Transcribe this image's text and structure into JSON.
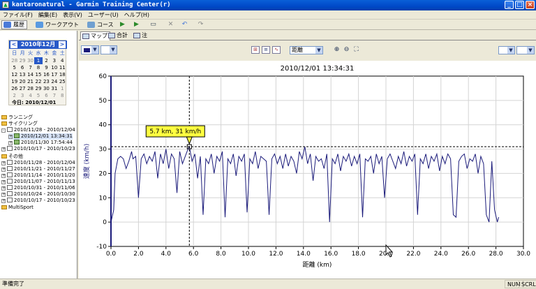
{
  "window": {
    "title": "kantaronatural - Garmin Training Center(r)",
    "app_icon": "garmin-icon"
  },
  "menu": [
    "ファイル(F)",
    "編集(E)",
    "表示(V)",
    "ユーザー(U)",
    "ヘルプ(H)"
  ],
  "toolbar": {
    "history_label": "履歴",
    "workout_label": "ワークアウト",
    "course_label": "コース"
  },
  "calendar": {
    "month_label": "2010年12月",
    "prev": "<",
    "next": ">",
    "weekdays": [
      "日",
      "月",
      "火",
      "水",
      "木",
      "金",
      "土"
    ],
    "days": [
      [
        "28",
        "29",
        "30",
        "1",
        "2",
        "3",
        "4"
      ],
      [
        "5",
        "6",
        "7",
        "8",
        "9",
        "10",
        "11"
      ],
      [
        "12",
        "13",
        "14",
        "15",
        "16",
        "17",
        "18"
      ],
      [
        "19",
        "20",
        "21",
        "22",
        "23",
        "24",
        "25"
      ],
      [
        "26",
        "27",
        "28",
        "29",
        "30",
        "31",
        "1"
      ],
      [
        "2",
        "3",
        "4",
        "5",
        "6",
        "7",
        "8"
      ]
    ],
    "selected_day": "1",
    "today_label": "今日: 2010/12/01"
  },
  "tree": {
    "running": "ランニング",
    "cycling": "サイクリング",
    "cycling_week1": "2010/11/28 - 2010/12/04",
    "cycling_act1": "2010/12/01 13:34:31",
    "cycling_act2": "2010/11/30 17:54:44",
    "cycling_week2": "2010/10/17 - 2010/10/23",
    "other": "その他",
    "other_weeks": [
      "2010/11/28 - 2010/12/04",
      "2010/11/21 - 2010/11/27",
      "2010/11/14 - 2010/11/20",
      "2010/11/07 - 2010/11/13",
      "2010/10/31 - 2010/11/06",
      "2010/10/24 - 2010/10/30",
      "2010/10/17 - 2010/10/23"
    ],
    "multisport": "MultiSport"
  },
  "tabs": {
    "map": "マップ",
    "total": "合計",
    "note": "注"
  },
  "chartbar": {
    "xaxis_select": "距離",
    "color": "#1a1a7a"
  },
  "chart_data": {
    "type": "line",
    "title": "2010/12/01 13:34:31",
    "xlabel": "距離 (km)",
    "ylabel": "速度 (km/h)",
    "xlim": [
      0,
      30
    ],
    "ylim": [
      -10,
      60
    ],
    "xticks": [
      "0.0",
      "2.0",
      "4.0",
      "6.0",
      "8.0",
      "10.0",
      "12.0",
      "14.0",
      "16.0",
      "18.0",
      "20.0",
      "22.0",
      "24.0",
      "26.0",
      "28.0",
      "30.0"
    ],
    "yticks": [
      "-10",
      "0",
      "10",
      "20",
      "30",
      "40",
      "50",
      "60"
    ],
    "grid": true,
    "cursor": {
      "x": 5.7,
      "y": 31,
      "label": "5.7 km, 31 km/h"
    },
    "series": [
      {
        "color": "#1a1a7a",
        "x": [
          0.0,
          0.2,
          0.3,
          0.5,
          0.7,
          0.9,
          1.1,
          1.3,
          1.5,
          1.6,
          1.8,
          2.0,
          2.2,
          2.4,
          2.6,
          2.8,
          3.0,
          3.2,
          3.4,
          3.6,
          3.8,
          4.0,
          4.2,
          4.4,
          4.6,
          4.8,
          5.0,
          5.2,
          5.4,
          5.6,
          5.7,
          5.9,
          6.1,
          6.3,
          6.5,
          6.7,
          6.9,
          7.1,
          7.3,
          7.5,
          7.7,
          7.9,
          8.1,
          8.3,
          8.5,
          8.7,
          8.9,
          9.1,
          9.3,
          9.5,
          9.7,
          9.9,
          10.1,
          10.3,
          10.5,
          10.7,
          10.9,
          11.1,
          11.3,
          11.5,
          11.7,
          11.9,
          12.1,
          12.3,
          12.5,
          12.7,
          12.9,
          13.1,
          13.3,
          13.5,
          13.7,
          13.9,
          14.1,
          14.3,
          14.5,
          14.7,
          14.9,
          15.1,
          15.3,
          15.5,
          15.7,
          15.9,
          16.1,
          16.3,
          16.5,
          16.7,
          16.9,
          17.1,
          17.3,
          17.5,
          17.7,
          17.9,
          18.1,
          18.3,
          18.5,
          18.7,
          18.9,
          19.1,
          19.3,
          19.5,
          19.7,
          19.9,
          20.1,
          20.3,
          20.5,
          20.7,
          20.9,
          21.1,
          21.3,
          21.5,
          21.7,
          21.9,
          22.1,
          22.3,
          22.5,
          22.7,
          22.9,
          23.1,
          23.3,
          23.5,
          23.7,
          23.9,
          24.1,
          24.3,
          24.5,
          24.7,
          24.9,
          25.1,
          25.3,
          25.5,
          25.7,
          25.9,
          26.1,
          26.3,
          26.5,
          26.7,
          26.9,
          27.1,
          27.3,
          27.5,
          27.7,
          27.9,
          28.1,
          28.2
        ],
        "y": [
          0,
          5,
          20,
          26,
          27,
          26,
          22,
          25,
          29,
          26,
          27,
          10,
          26,
          28,
          24,
          27,
          25,
          29,
          18,
          28,
          24,
          30,
          22,
          28,
          26,
          12,
          29,
          24,
          27,
          30,
          31,
          25,
          28,
          18,
          27,
          3,
          26,
          24,
          28,
          20,
          27,
          25,
          29,
          2,
          26,
          24,
          28,
          19,
          27,
          25,
          28,
          4,
          26,
          24,
          29,
          22,
          27,
          26,
          25,
          3,
          26,
          28,
          24,
          27,
          22,
          28,
          23,
          27,
          25,
          20,
          29,
          26,
          31,
          24,
          28,
          17,
          27,
          25,
          26,
          22,
          28,
          0,
          26,
          24,
          28,
          21,
          27,
          25,
          28,
          23,
          27,
          24,
          28,
          2,
          26,
          25,
          27,
          20,
          28,
          24,
          27,
          10,
          26,
          28,
          25,
          22,
          27,
          24,
          29,
          23,
          27,
          25,
          28,
          3,
          26,
          24,
          28,
          22,
          27,
          25,
          28,
          21,
          27,
          24,
          28,
          26,
          3,
          2,
          25,
          27,
          28,
          22,
          26,
          25,
          28,
          20,
          27,
          24,
          3,
          0,
          25,
          5,
          0,
          2
        ]
      }
    ]
  },
  "status": {
    "ready": "準備完了",
    "num": "NUM",
    "scrl": "SCRL"
  }
}
